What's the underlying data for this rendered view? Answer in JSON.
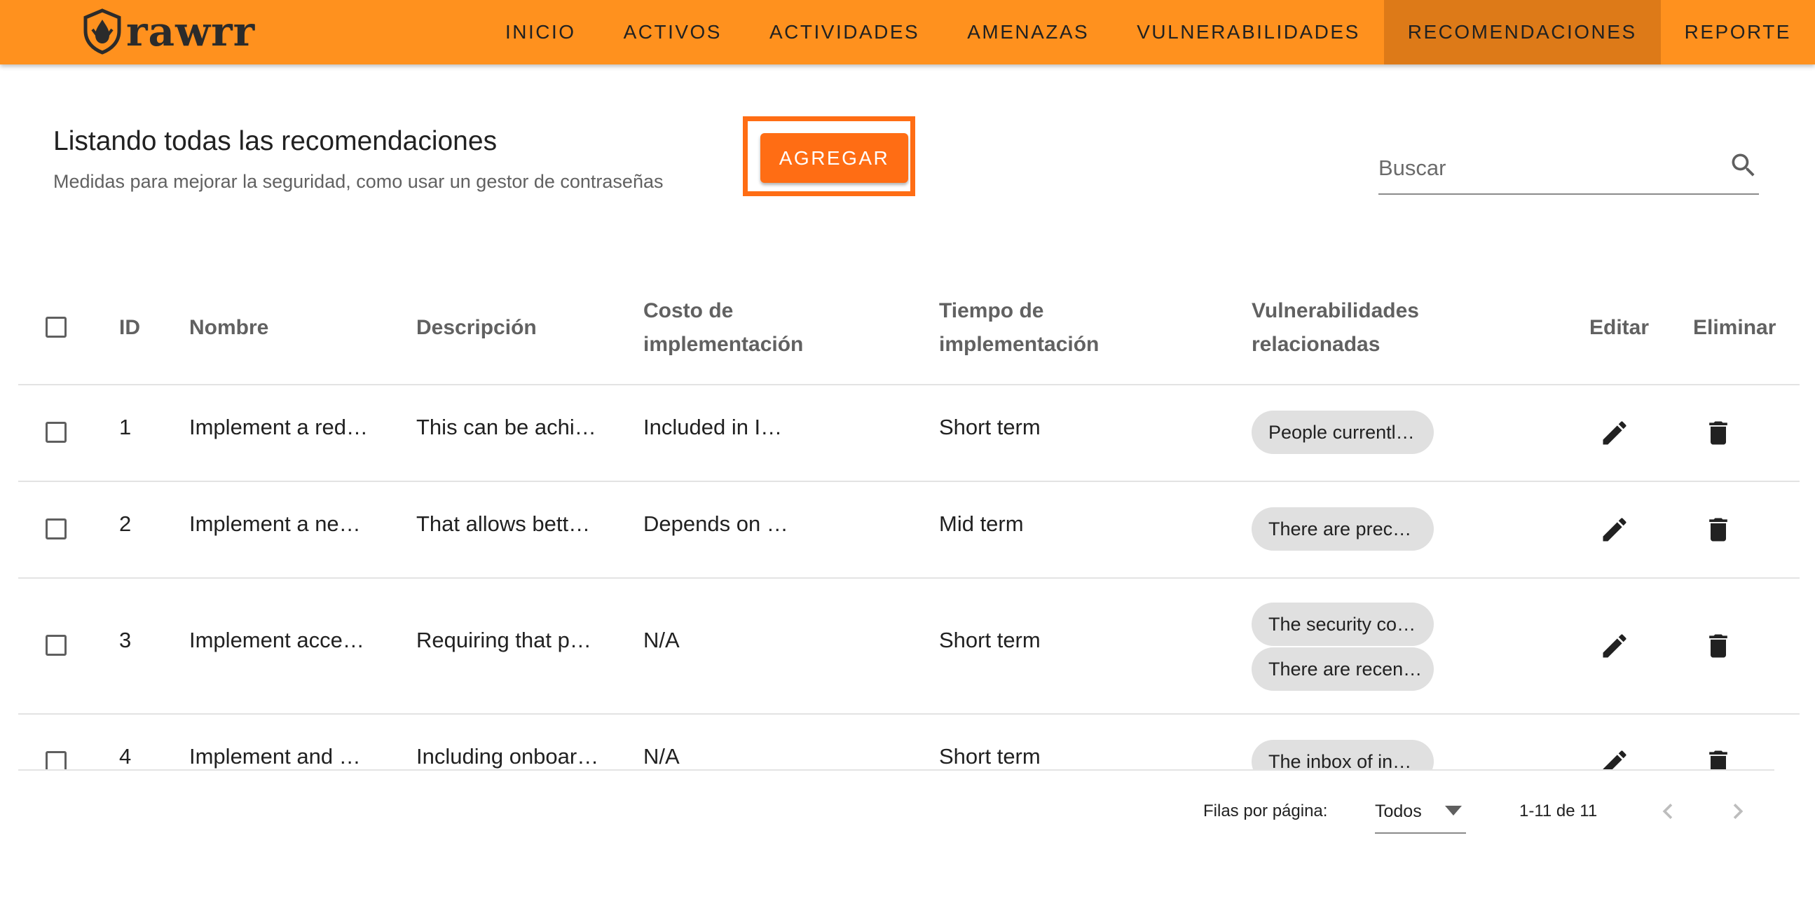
{
  "app": {
    "logo_text": "rawrr"
  },
  "nav": {
    "items": [
      {
        "label": "INICIO"
      },
      {
        "label": "ACTIVOS"
      },
      {
        "label": "ACTIVIDADES"
      },
      {
        "label": "AMENAZAS"
      },
      {
        "label": "VULNERABILIDADES"
      },
      {
        "label": "RECOMENDACIONES",
        "active": true
      },
      {
        "label": "REPORTE"
      }
    ]
  },
  "header": {
    "title": "Listando todas las recomendaciones",
    "subtitle": "Medidas para mejorar la seguridad, como usar un gestor de contraseñas",
    "add_label": "AGREGAR",
    "search_placeholder": "Buscar"
  },
  "table": {
    "columns": {
      "id": "ID",
      "name": "Nombre",
      "description": "Descripción",
      "cost_l1": "Costo de",
      "cost_l2": "implementación",
      "time_l1": "Tiempo de",
      "time_l2": "implementación",
      "vulns_l1": "Vulnerabilidades",
      "vulns_l2": "relacionadas",
      "edit": "Editar",
      "delete": "Eliminar"
    },
    "rows": [
      {
        "id": "1",
        "name": "Implement a red…",
        "description": "This can be achi…",
        "cost": "Included in I…",
        "time": "Short term",
        "vulns": [
          "People currentl…"
        ]
      },
      {
        "id": "2",
        "name": "Implement a ne…",
        "description": "That allows bett…",
        "cost": "Depends on …",
        "time": "Mid term",
        "vulns": [
          "There are prec…"
        ]
      },
      {
        "id": "3",
        "name": "Implement acce…",
        "description": "Requiring that p…",
        "cost": "N/A",
        "time": "Short term",
        "vulns": [
          "The security co…",
          "There are recen…"
        ]
      },
      {
        "id": "4",
        "name": "Implement and …",
        "description": "Including onboar…",
        "cost": "N/A",
        "time": "Short term",
        "vulns": [
          "The inbox of in…"
        ]
      }
    ]
  },
  "footer": {
    "rows_per_page_label": "Filas por página:",
    "rows_per_page_value": "Todos",
    "range_label": "1-11 de 11"
  },
  "colors": {
    "topbar": "#ff911e",
    "nav_active": "#dd7a18",
    "accent": "#ff6d14",
    "chip": "#e0e0e0"
  },
  "icons": {
    "search": "search-icon",
    "edit": "pencil-icon",
    "delete": "trash-icon",
    "prev_page": "chevron-left-icon",
    "next_page": "chevron-right-icon",
    "select_caret": "caret-down-icon"
  }
}
